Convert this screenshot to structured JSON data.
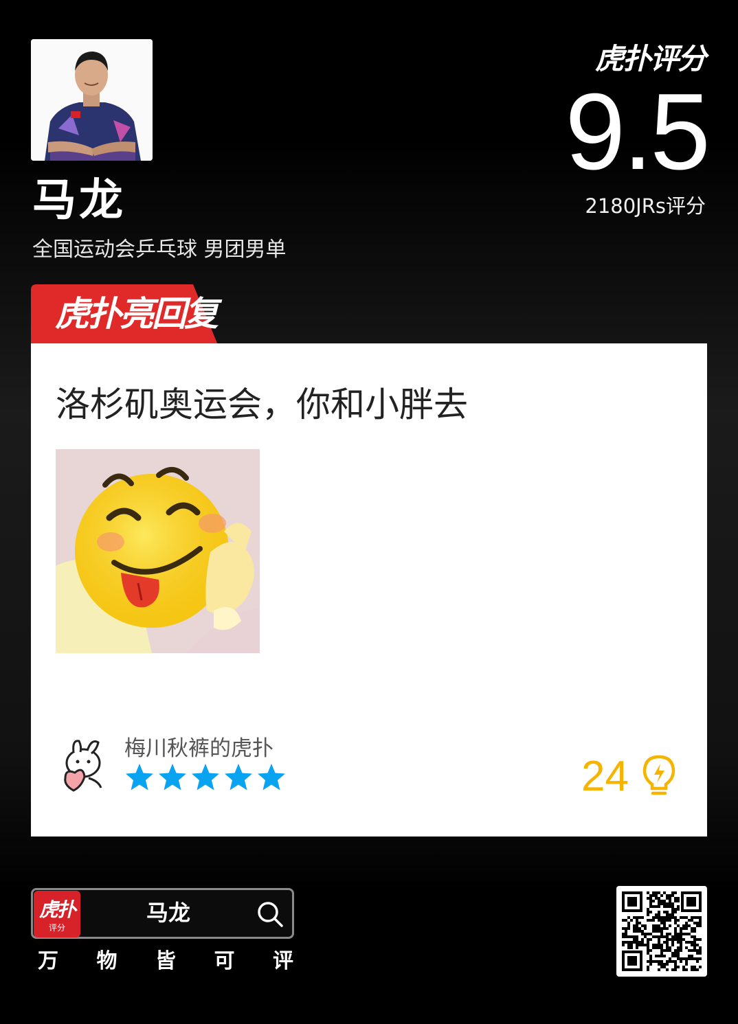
{
  "header": {
    "name": "马龙",
    "subtitle": "全国运动会乒乓球 男团男单",
    "brand_label": "虎扑评分",
    "score": "9.5",
    "raters": "2180JRs评分"
  },
  "badge": {
    "label": "虎扑亮回复",
    "color": "#e02a2a"
  },
  "card": {
    "comment": "洛杉矶奥运会，你和小胖去",
    "emoji_image": "smiling-tongue-thumbs-up-emoji",
    "username": "梅川秋裤的虎扑",
    "rating_stars": 5,
    "likes": "24"
  },
  "footer": {
    "app_logo_text": "虎扑",
    "app_logo_sub": "评分",
    "search_text": "马龙",
    "slogan": [
      "万",
      "物",
      "皆",
      "可",
      "评"
    ]
  },
  "colors": {
    "accent_red": "#e02a2a",
    "star_blue": "#0aa3f0",
    "likes_gold": "#f5b400"
  }
}
